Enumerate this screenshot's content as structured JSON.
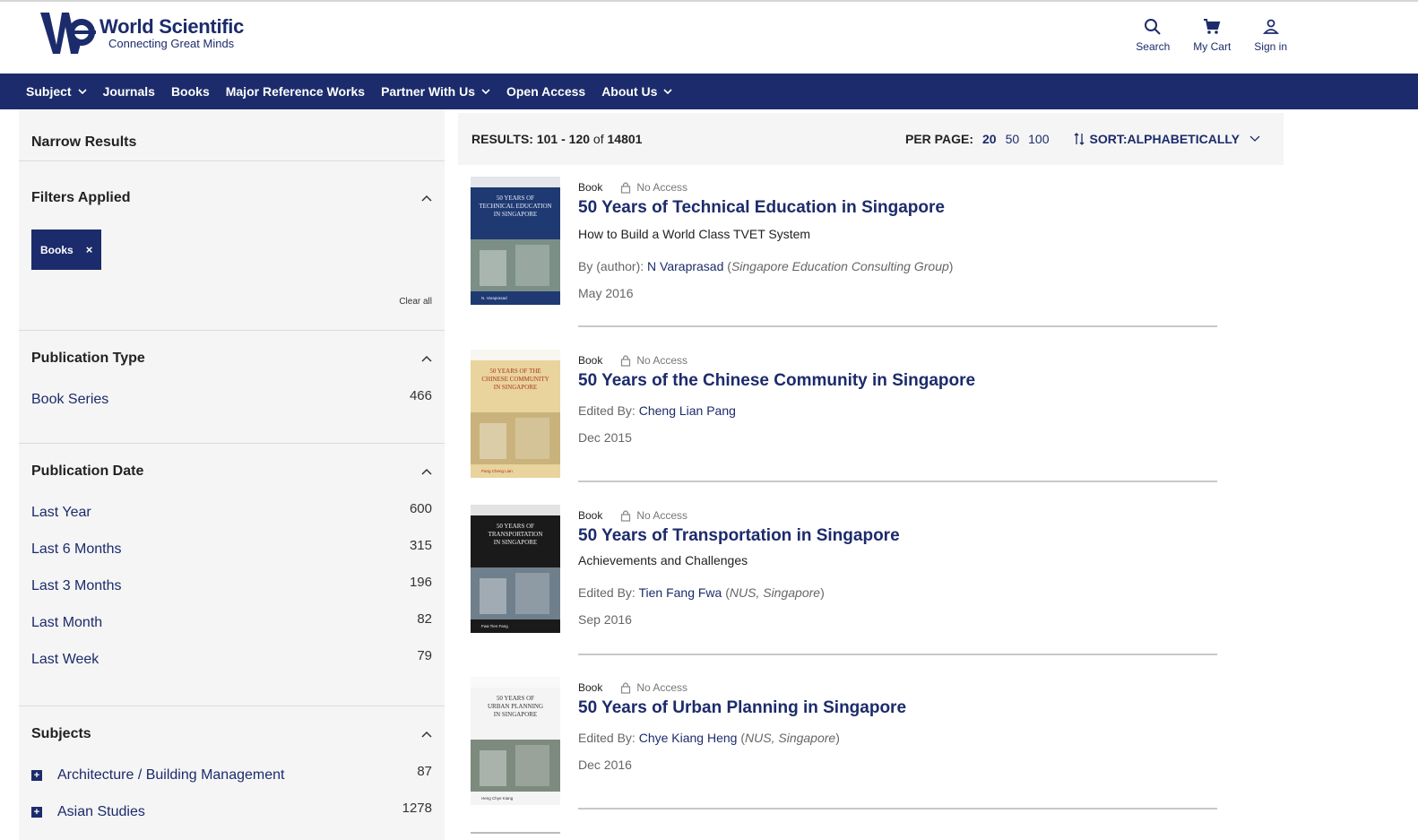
{
  "brand": {
    "name": "World Scientific",
    "tagline": "Connecting Great Minds"
  },
  "header_actions": [
    {
      "label": "Search",
      "icon": "search-icon"
    },
    {
      "label": "My Cart",
      "icon": "cart-icon"
    },
    {
      "label": "Sign in",
      "icon": "user-icon"
    }
  ],
  "nav": [
    {
      "label": "Subject",
      "dropdown": true
    },
    {
      "label": "Journals",
      "dropdown": false
    },
    {
      "label": "Books",
      "dropdown": false
    },
    {
      "label": "Major Reference Works",
      "dropdown": false
    },
    {
      "label": "Partner With Us",
      "dropdown": true
    },
    {
      "label": "Open Access",
      "dropdown": false
    },
    {
      "label": "About Us",
      "dropdown": true
    }
  ],
  "sidebar": {
    "narrow_title": "Narrow Results",
    "filters_applied": {
      "title": "Filters Applied",
      "chip": "Books",
      "chip_remove": "×",
      "clear_all": "Clear all"
    },
    "publication_type": {
      "title": "Publication Type",
      "items": [
        {
          "label": "Book Series",
          "count": "466"
        }
      ]
    },
    "publication_date": {
      "title": "Publication Date",
      "items": [
        {
          "label": "Last Year",
          "count": "600"
        },
        {
          "label": "Last 6 Months",
          "count": "315"
        },
        {
          "label": "Last 3 Months",
          "count": "196"
        },
        {
          "label": "Last Month",
          "count": "82"
        },
        {
          "label": "Last Week",
          "count": "79"
        }
      ]
    },
    "subjects": {
      "title": "Subjects",
      "items": [
        {
          "label": "Architecture / Building Management",
          "count": "87"
        },
        {
          "label": "Asian Studies",
          "count": "1278"
        }
      ]
    }
  },
  "results_bar": {
    "results_label": "RESULTS:",
    "range": "101 - 120",
    "of": "of",
    "total": "14801",
    "per_page_label": "PER PAGE:",
    "per_page_options": [
      "20",
      "50",
      "100"
    ],
    "per_page_selected": "20",
    "sort_label": "SORT:ALPHABETICALLY"
  },
  "results": [
    {
      "type": "Book",
      "access": "No Access",
      "title": "50 Years of Technical Education in Singapore",
      "subtitle": "How to Build a World Class TVET System",
      "role": "By (author):",
      "author": "N Varaprasad",
      "affiliation": "Singapore Education Consulting Group",
      "date": "May 2016",
      "cover": {
        "bg": "#1f3a72",
        "title_lines": [
          "50 YEARS OF",
          "TECHNICAL EDUCATION",
          "IN SINGAPORE"
        ],
        "text_color": "#e9eef8",
        "author": "N. Varaprasad",
        "photo": "#7c8f86"
      }
    },
    {
      "type": "Book",
      "access": "No Access",
      "title": "50 Years of the Chinese Community in Singapore",
      "subtitle": "",
      "role": "Edited By:",
      "author": "Cheng Lian Pang",
      "affiliation": "",
      "date": "Dec 2015",
      "cover": {
        "bg": "#e8d49c",
        "title_lines": [
          "50 YEARS OF THE",
          "CHINESE COMMUNITY",
          "IN SINGAPORE"
        ],
        "text_color": "#b0322a",
        "author": "Pang Cheng Lian",
        "photo": "#c9b27c"
      }
    },
    {
      "type": "Book",
      "access": "No Access",
      "title": "50 Years of Transportation in Singapore",
      "subtitle": "Achievements and Challenges",
      "role": "Edited By:",
      "author": "Tien Fang Fwa",
      "affiliation": "NUS, Singapore",
      "date": "Sep 2016",
      "cover": {
        "bg": "#1a1a1a",
        "title_lines": [
          "50 YEARS OF",
          "TRANSPORTATION",
          "IN SINGAPORE"
        ],
        "text_color": "#f0f0f0",
        "author": "Fwa Tien Fang",
        "photo": "#6f7f8c"
      }
    },
    {
      "type": "Book",
      "access": "No Access",
      "title": "50 Years of Urban Planning in Singapore",
      "subtitle": "",
      "role": "Edited By:",
      "author": "Chye Kiang Heng",
      "affiliation": "NUS, Singapore",
      "date": "Dec 2016",
      "cover": {
        "bg": "#f4f4f4",
        "title_lines": [
          "50 YEARS OF",
          "URBAN PLANNING",
          "IN SINGAPORE"
        ],
        "text_color": "#333333",
        "author": "Heng Chye Kiang",
        "photo": "#7d8a7e"
      }
    }
  ],
  "colors": {
    "brand": "#1c2b6b",
    "panel": "#f5f5f5",
    "divider": "#c8c8c8"
  }
}
